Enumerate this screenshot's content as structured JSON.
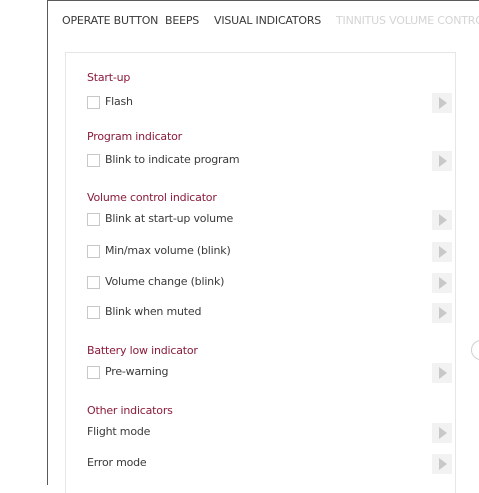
{
  "tabs": [
    {
      "label": "OPERATE BUTTON",
      "state": "normal"
    },
    {
      "label": "BEEPS",
      "state": "normal"
    },
    {
      "label": "VISUAL INDICATORS",
      "state": "active"
    },
    {
      "label": "TINNITUS VOLUME CONTROL",
      "state": "disabled"
    }
  ],
  "sections": {
    "startup": {
      "title": "Start-up",
      "rows": [
        {
          "label": "Flash",
          "checked": false,
          "icon": "play-icon"
        }
      ]
    },
    "program": {
      "title": "Program indicator",
      "rows": [
        {
          "label": "Blink to indicate program",
          "checked": false,
          "icon": "play-icon"
        }
      ]
    },
    "volume": {
      "title": "Volume control indicator",
      "rows": [
        {
          "label": "Blink at start-up volume",
          "checked": false,
          "icon": "play-icon"
        },
        {
          "label": "Min/max volume (blink)",
          "checked": false,
          "icon": "play-icon"
        },
        {
          "label": "Volume change (blink)",
          "checked": false,
          "icon": "play-icon"
        },
        {
          "label": "Blink when muted",
          "checked": false,
          "icon": "play-icon"
        }
      ]
    },
    "battery": {
      "title": "Battery low indicator",
      "rows": [
        {
          "label": "Pre-warning",
          "checked": false,
          "icon": "play-icon"
        }
      ]
    },
    "other": {
      "title": "Other indicators",
      "rows": [
        {
          "label": "Flight mode",
          "icon": "play-icon"
        },
        {
          "label": "Error mode",
          "icon": "play-icon"
        }
      ]
    }
  },
  "colors": {
    "section_title": "#8a1c3b",
    "text": "#3a3a3a",
    "disabled_tab": "#d4d4d4",
    "play_button_bg": "#f2f2f2",
    "play_icon": "#c8c8c8"
  }
}
